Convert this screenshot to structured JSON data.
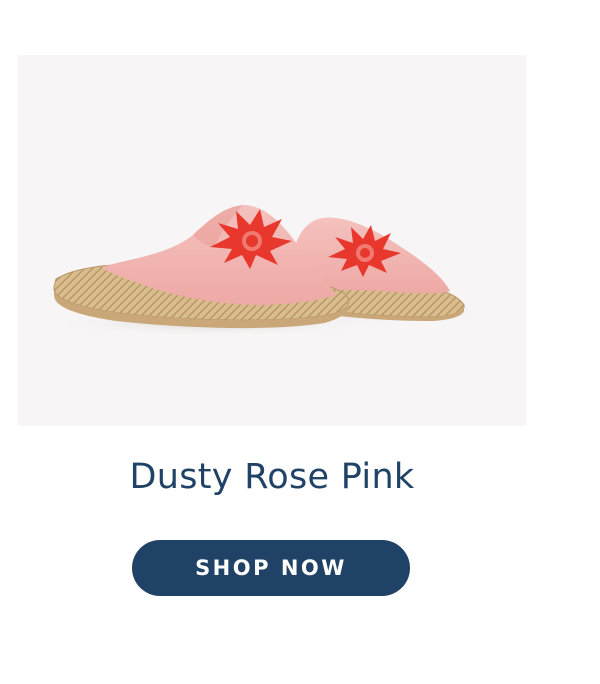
{
  "product": {
    "image_name": "pink-espadrille-mules-photo",
    "title": "Dusty Rose Pink",
    "cta_label": "SHOP NOW"
  },
  "colors": {
    "title": "#1f4266",
    "button_bg": "#1f4266",
    "button_text": "#ffffff",
    "image_bg": "#f7f5f5",
    "shoe_pink": "#f2b3b0",
    "embroidery_red": "#e8382d",
    "jute": "#d9bd8c"
  }
}
